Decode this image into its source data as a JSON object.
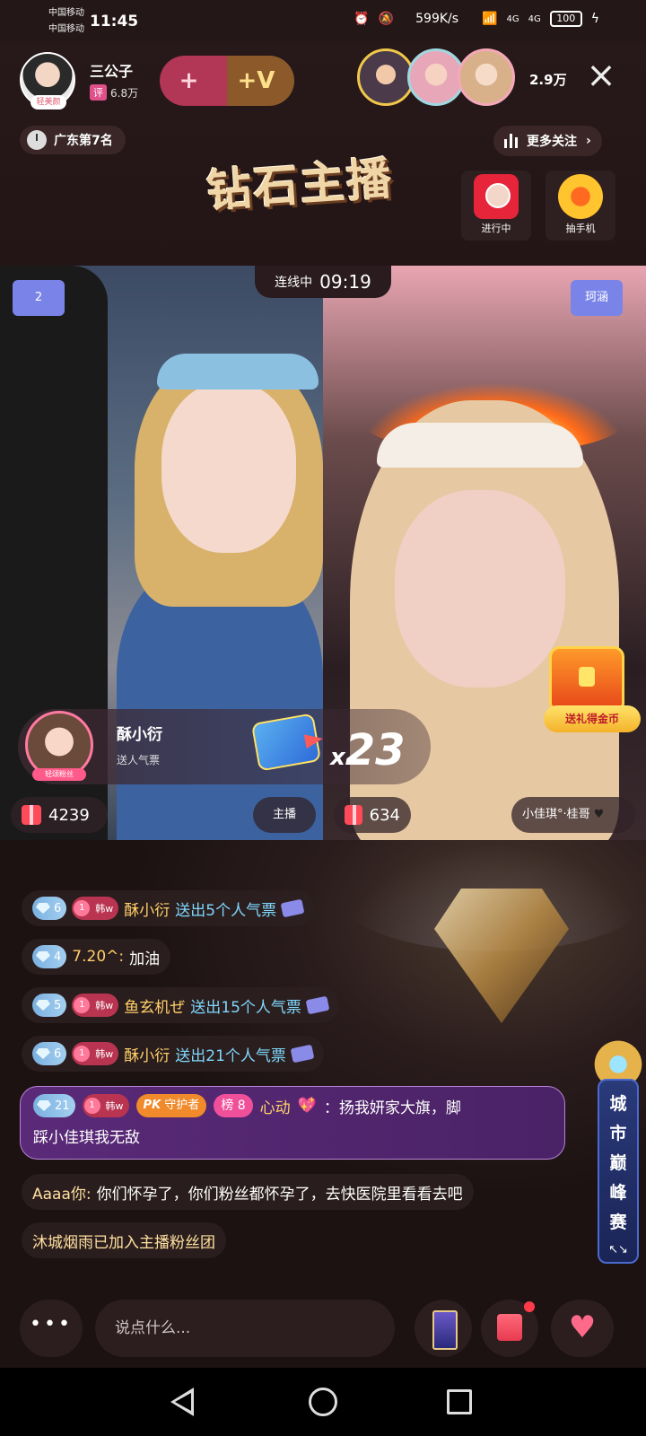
{
  "status_bar": {
    "carrier_1": "中国移动",
    "carrier_2": "中国移动",
    "time": "11:45",
    "net_speed": "599K/s",
    "signal_1": "4G",
    "signal_2": "4G",
    "battery": "100"
  },
  "host": {
    "name": "三公子",
    "tag": "轻美颜",
    "rating_badge": "评",
    "rating_count": "6.8万"
  },
  "follow_pill": {
    "heart_label": "+",
    "v_label": "+V"
  },
  "viewers": {
    "count": "2.9万"
  },
  "rank": {
    "label": "广东第7名"
  },
  "more_follow": {
    "label": "更多关注"
  },
  "banner_title": "钻石主播",
  "activities": [
    {
      "label": "进行中"
    },
    {
      "label": "抽手机"
    }
  ],
  "pk": {
    "status": "连线中",
    "timer": "09:19",
    "left_tag": "2",
    "right_tag": "珂涵",
    "left_score": "4239",
    "right_score": "634",
    "left_role": "主播",
    "right_partner": "小佳琪°·桂哥"
  },
  "gift_banner": {
    "sender": "酥小衍",
    "action": "送人气票",
    "fan_badge": "轻颂粉丝",
    "gift_label": "人气票",
    "multiplier_prefix": "x",
    "count": "23"
  },
  "treasure": {
    "label": "送礼得金币"
  },
  "chat": [
    {
      "level": "6",
      "fan_level": "1",
      "fan_name": "韩w",
      "user": "酥小衍",
      "text": "送出5个人气票"
    },
    {
      "level": "4",
      "user": "7.20^:",
      "text": "加油"
    },
    {
      "level": "5",
      "fan_level": "1",
      "fan_name": "韩w",
      "user": "鱼玄机ぜ",
      "text": "送出15个人气票"
    },
    {
      "level": "6",
      "fan_level": "1",
      "fan_name": "韩w",
      "user": "酥小衍",
      "text": "送出21个人气票"
    }
  ],
  "special_msg": {
    "level": "21",
    "fan_level": "1",
    "fan_name": "韩w",
    "pk_label": "PK",
    "guard_label": "守护者",
    "rank_label": "榜 8",
    "user": "心动",
    "text_1": "：扬我妍家大旗，脚",
    "text_2": "踩小佳琪我无敌"
  },
  "msg_aaa": {
    "user": "Aaaa你:",
    "text": "你们怀孕了，你们粉丝都怀孕了，去快医院里看看去吧"
  },
  "msg_join": {
    "text": "沐城烟雨已加入主播粉丝团"
  },
  "city_banner": {
    "text": "城市巅峰赛",
    "expand": "↖↘"
  },
  "input": {
    "placeholder": "说点什么...",
    "more": "•••"
  },
  "like_label": "♥"
}
